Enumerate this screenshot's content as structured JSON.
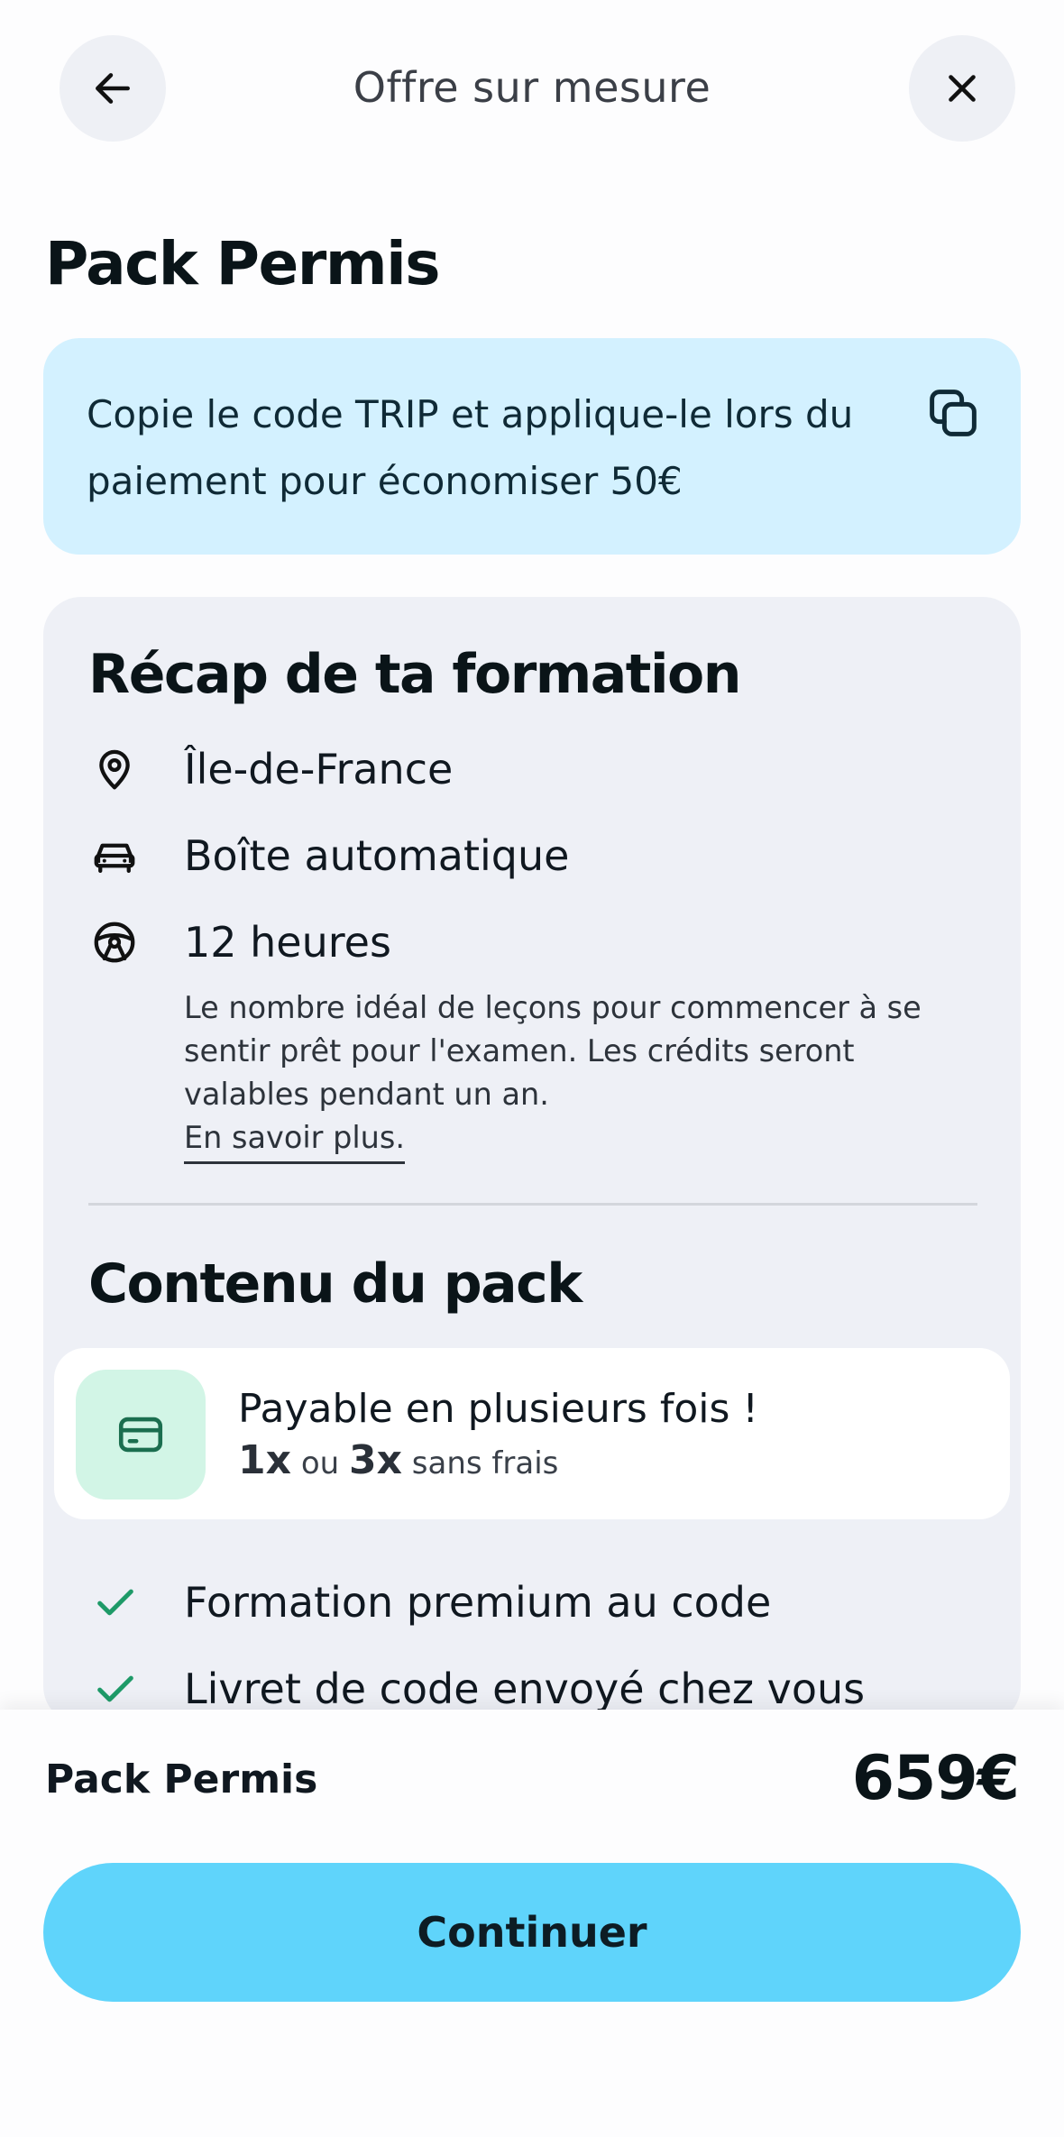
{
  "header": {
    "title": "Offre sur mesure",
    "back_icon": "arrow-left-icon",
    "close_icon": "close-icon"
  },
  "page": {
    "title": "Pack Permis"
  },
  "promo": {
    "text": "Copie le code TRIP et applique-le lors du paiement pour économiser 50€",
    "icon": "copy-icon",
    "background": "#d3f1ff"
  },
  "recap": {
    "title": "Récap de ta formation",
    "items": [
      {
        "icon": "location-pin-icon",
        "label": "Île-de-France"
      },
      {
        "icon": "car-icon",
        "label": "Boîte automatique"
      },
      {
        "icon": "steering-wheel-icon",
        "label": "12 heures"
      }
    ],
    "hours_description": "Le nombre idéal de leçons pour commencer à se sentir prêt pour l'examen. Les crédits seront valables pendant un an.",
    "learn_more": "En savoir plus."
  },
  "pack": {
    "title": "Contenu du pack",
    "payment": {
      "icon": "credit-card-icon",
      "title": "Payable en plusieurs fois !",
      "option_one": "1x",
      "connector": "ou",
      "option_two": "3x",
      "suffix": "sans frais"
    },
    "features": [
      "Formation premium au code",
      "Livret de code envoyé chez vous"
    ]
  },
  "summary": {
    "label": "Pack Permis",
    "price": "659€",
    "cta": "Continuer"
  },
  "colors": {
    "accent": "#5fd4fb",
    "check": "#1e9a68",
    "card": "#eef0f6"
  }
}
